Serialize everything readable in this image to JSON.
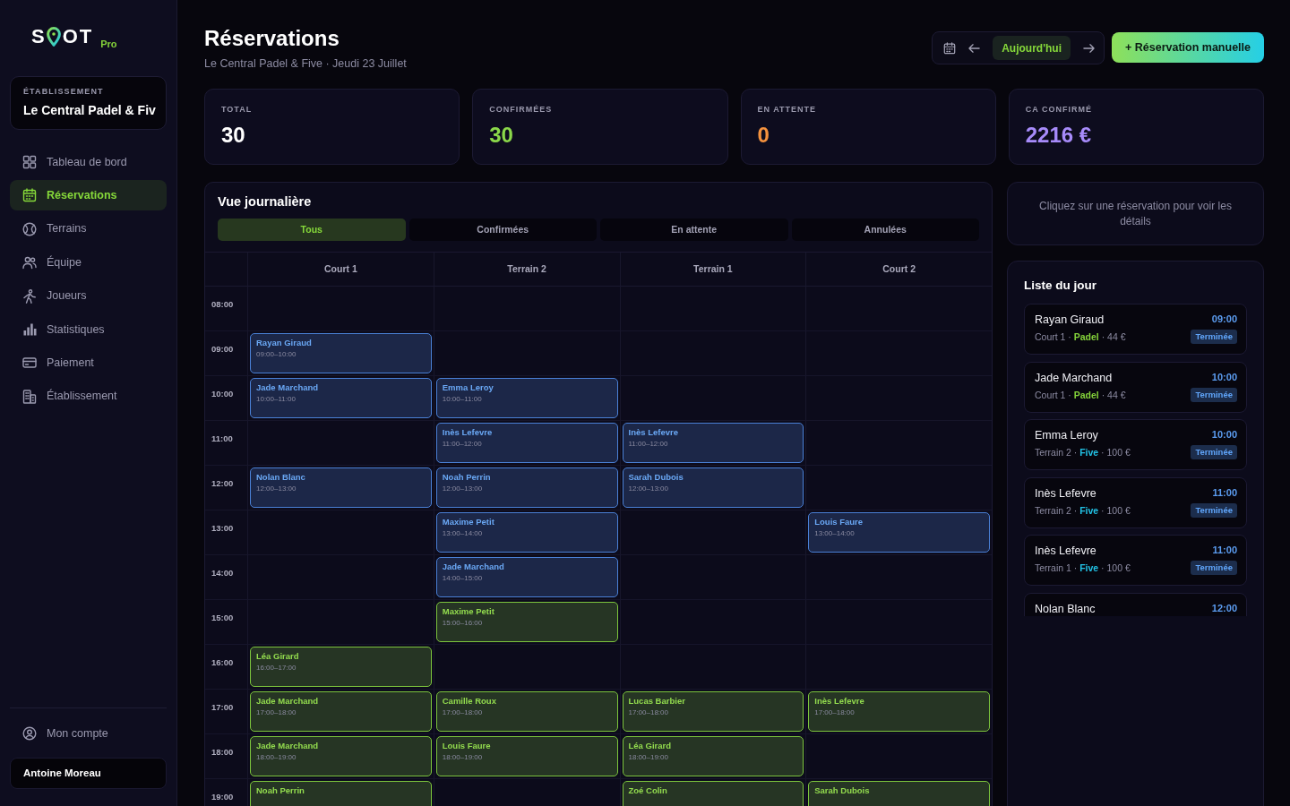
{
  "sidebar": {
    "logo": {
      "text_start": "S",
      "text_end": "OT",
      "suffix": "Pro"
    },
    "venue": {
      "label": "ÉTABLISSEMENT",
      "name": "Le Central Padel & Fiv"
    },
    "items": [
      {
        "label": "Tableau de bord",
        "selected": false
      },
      {
        "label": "Réservations",
        "selected": true
      },
      {
        "label": "Terrains",
        "selected": false
      },
      {
        "label": "Équipe",
        "selected": false
      },
      {
        "label": "Joueurs",
        "selected": false
      },
      {
        "label": "Statistiques",
        "selected": false
      },
      {
        "label": "Paiement",
        "selected": false
      },
      {
        "label": "Établissement",
        "selected": false
      }
    ],
    "account": {
      "label": "Mon compte"
    },
    "user": {
      "name": "Antoine Moreau"
    }
  },
  "header": {
    "title": "Réservations",
    "subtitle": "Le Central Padel & Five · Jeudi 23 Juillet",
    "today_button": "Aujourd'hui",
    "action_button": "+ Réservation manuelle"
  },
  "stats": [
    {
      "label": "TOTAL",
      "value": "30",
      "color": "#ffffff"
    },
    {
      "label": "CONFIRMÉES",
      "value": "30",
      "color": "#8bd84a"
    },
    {
      "label": "EN ATTENTE",
      "value": "0",
      "color": "#f5923e"
    },
    {
      "label": "CA CONFIRMÉ",
      "value": "2216 €",
      "color": "#a78bfa"
    }
  ],
  "calendar": {
    "title": "Vue journalière",
    "filters": [
      {
        "label": "Tous",
        "selected": true
      },
      {
        "label": "Confirmées",
        "selected": false
      },
      {
        "label": "En attente",
        "selected": false
      },
      {
        "label": "Annulées",
        "selected": false
      }
    ],
    "columns": [
      "Court 1",
      "Terrain 2",
      "Terrain 1",
      "Court 2"
    ],
    "rows": [
      {
        "time": "08:00",
        "cells": [
          null,
          null,
          null,
          null
        ]
      },
      {
        "time": "09:00",
        "cells": [
          {
            "name": "Rayan Giraud",
            "time": "09:00–10:00",
            "finished": true
          },
          null,
          null,
          null
        ]
      },
      {
        "time": "10:00",
        "cells": [
          {
            "name": "Jade Marchand",
            "time": "10:00–11:00",
            "finished": true
          },
          {
            "name": "Emma Leroy",
            "time": "10:00–11:00",
            "finished": true
          },
          null,
          null
        ]
      },
      {
        "time": "11:00",
        "cells": [
          null,
          {
            "name": "Inès Lefevre",
            "time": "11:00–12:00",
            "finished": true
          },
          {
            "name": "Inès Lefevre",
            "time": "11:00–12:00",
            "finished": true
          },
          null
        ]
      },
      {
        "time": "12:00",
        "cells": [
          {
            "name": "Nolan Blanc",
            "time": "12:00–13:00",
            "finished": true
          },
          {
            "name": "Noah Perrin",
            "time": "12:00–13:00",
            "finished": true
          },
          {
            "name": "Sarah Dubois",
            "time": "12:00–13:00",
            "finished": true
          },
          null
        ]
      },
      {
        "time": "13:00",
        "cells": [
          null,
          {
            "name": "Maxime Petit",
            "time": "13:00–14:00",
            "finished": true
          },
          null,
          {
            "name": "Louis Faure",
            "time": "13:00–14:00",
            "finished": true
          }
        ]
      },
      {
        "time": "14:00",
        "cells": [
          null,
          {
            "name": "Jade Marchand",
            "time": "14:00–15:00",
            "finished": true
          },
          null,
          null
        ]
      },
      {
        "time": "15:00",
        "cells": [
          null,
          {
            "name": "Maxime Petit",
            "time": "15:00–16:00",
            "finished": false
          },
          null,
          null
        ]
      },
      {
        "time": "16:00",
        "cells": [
          {
            "name": "Léa Girard",
            "time": "16:00–17:00",
            "finished": false
          },
          null,
          null,
          null
        ]
      },
      {
        "time": "17:00",
        "cells": [
          {
            "name": "Jade Marchand",
            "time": "17:00–18:00",
            "finished": false
          },
          {
            "name": "Camille Roux",
            "time": "17:00–18:00",
            "finished": false
          },
          {
            "name": "Lucas Barbier",
            "time": "17:00–18:00",
            "finished": false
          },
          {
            "name": "Inès Lefevre",
            "time": "17:00–18:00",
            "finished": false
          }
        ]
      },
      {
        "time": "18:00",
        "cells": [
          {
            "name": "Jade Marchand",
            "time": "18:00–19:00",
            "finished": false
          },
          {
            "name": "Louis Faure",
            "time": "18:00–19:00",
            "finished": false
          },
          {
            "name": "Léa Girard",
            "time": "18:00–19:00",
            "finished": false
          },
          null
        ]
      },
      {
        "time": "19:00",
        "cells": [
          {
            "name": "Noah Perrin",
            "finished": false
          },
          null,
          {
            "name": "Zoé Colin",
            "finished": false
          },
          {
            "name": "Sarah Dubois",
            "finished": false
          }
        ]
      }
    ]
  },
  "details": {
    "message": "Cliquez sur une réservation pour voir les détails"
  },
  "day_list": {
    "title": "Liste du jour",
    "items": [
      {
        "name": "Rayan Giraud",
        "meta": "Court 1 · **Padel** · 44 €",
        "color": "#84d23a",
        "time": "09:00",
        "status": "Terminée"
      },
      {
        "name": "Jade Marchand",
        "meta": "Court 1 · **Padel** · 44 €",
        "color": "#84d23a",
        "time": "10:00",
        "status": "Terminée"
      },
      {
        "name": "Emma Leroy",
        "meta": "Terrain 2 · **Five** · 100 €",
        "color": "#22c3e6",
        "time": "10:00",
        "status": "Terminée"
      },
      {
        "name": "Inès Lefevre",
        "meta": "Terrain 2 · **Five** · 100 €",
        "color": "#22c3e6",
        "time": "11:00",
        "status": "Terminée"
      },
      {
        "name": "Inès Lefevre",
        "meta": "Terrain 1 · **Five** · 100 €",
        "color": "#22c3e6",
        "time": "11:00",
        "status": "Terminée"
      },
      {
        "name": "Nolan Blanc",
        "time": "12:00"
      }
    ]
  }
}
